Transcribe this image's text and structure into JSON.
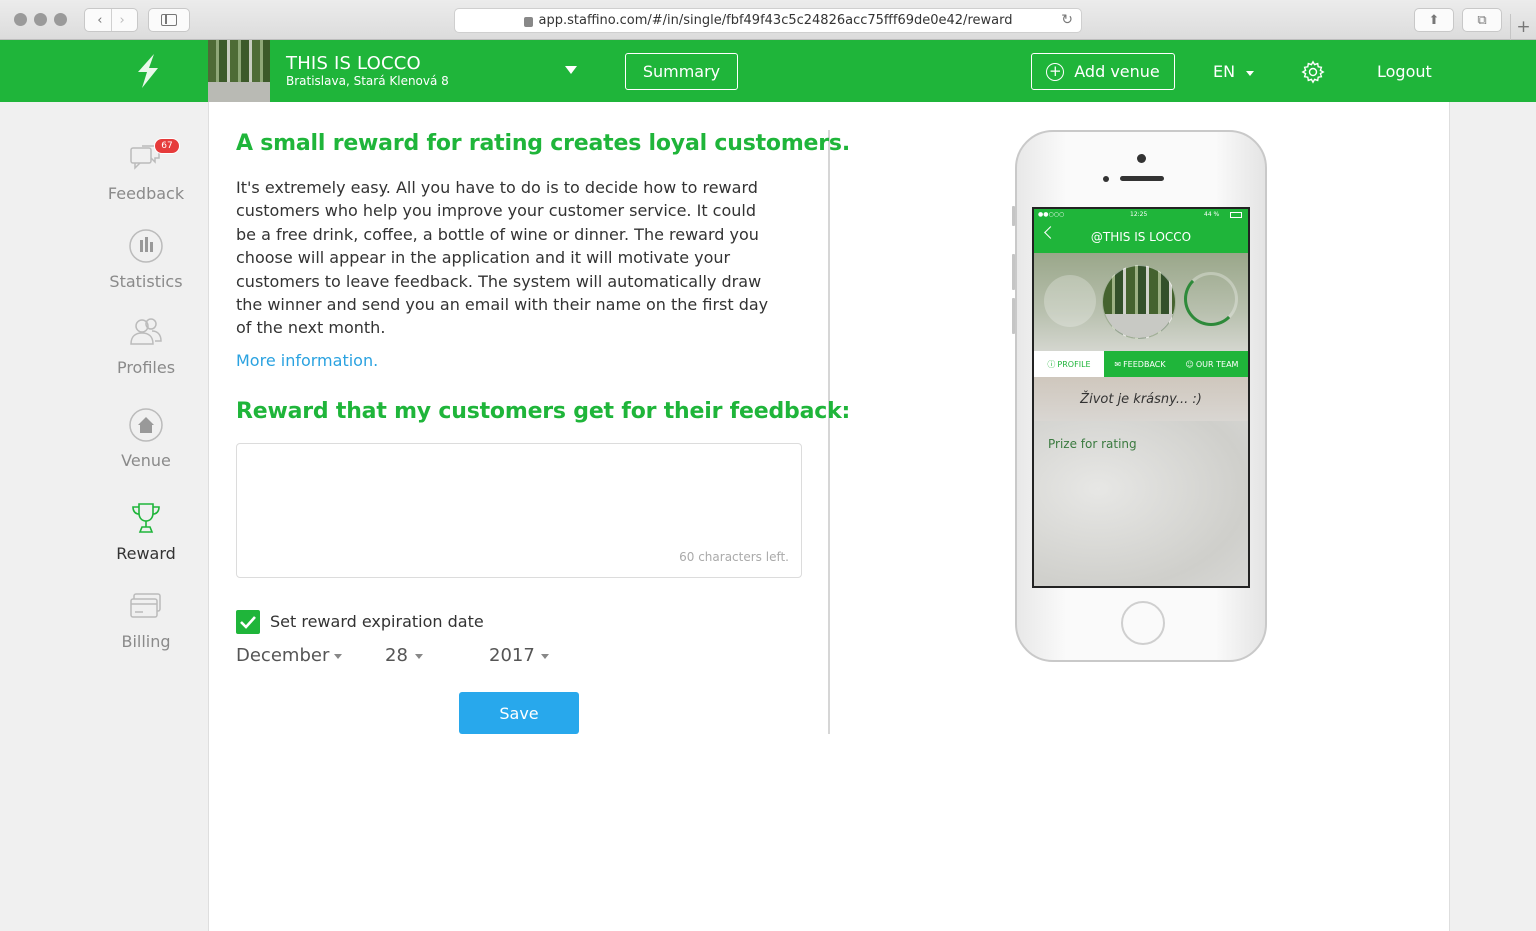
{
  "browser": {
    "url": "app.staffino.com/#/in/single/fbf49f43c5c24826acc75fff69de0e42/reward"
  },
  "header": {
    "venue_name": "THIS IS LOCCO",
    "venue_address": "Bratislava, Stará Klenová 8",
    "summary_label": "Summary",
    "add_venue_label": "Add venue",
    "language": "EN",
    "logout_label": "Logout",
    "brand_color": "#1fb53a"
  },
  "sidebar": {
    "feedback_badge": "67",
    "items": [
      {
        "label": "Feedback",
        "icon": "chat-bubbles-icon"
      },
      {
        "label": "Statistics",
        "icon": "bar-chart-icon"
      },
      {
        "label": "Profiles",
        "icon": "people-icon"
      },
      {
        "label": "Venue",
        "icon": "home-icon"
      },
      {
        "label": "Reward",
        "icon": "trophy-icon",
        "active": true
      },
      {
        "label": "Billing",
        "icon": "credit-card-icon"
      }
    ]
  },
  "main": {
    "heading": "A small reward for rating creates loyal customers.",
    "description": "It's extremely easy. All you have to do is to decide how to reward customers who help you improve your customer service. It could be a free drink, coffee, a bottle of wine or dinner. The reward you choose will appear in the application and it will motivate your customers to leave feedback. The system will automatically draw the winner and send you an email with their name on the first day of the next month.",
    "more_info": "More information.",
    "reward_heading": "Reward that my customers get for their feedback:",
    "reward_value": "",
    "chars_left": "60 characters left.",
    "expiration_checked": true,
    "expiration_label": "Set reward expiration date",
    "month": "December",
    "day": "28",
    "year": "2017",
    "save_label": "Save"
  },
  "phone": {
    "time": "12:25",
    "battery": "44 %",
    "title": "@THIS IS LOCCO",
    "tabs": [
      "PROFILE",
      "FEEDBACK",
      "OUR TEAM"
    ],
    "quote": "Život je krásny... :)",
    "prize_label": "Prize for rating"
  }
}
